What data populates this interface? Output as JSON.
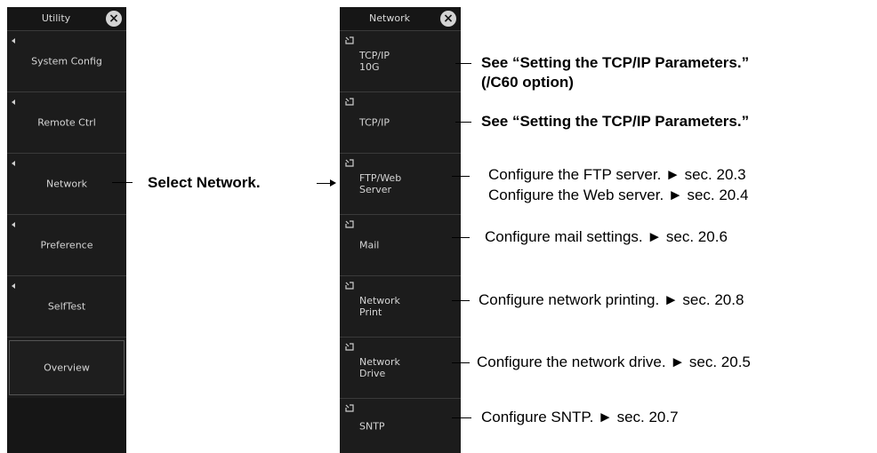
{
  "utility": {
    "title": "Utility",
    "close_glyph": "×",
    "items": [
      {
        "label": "System Config"
      },
      {
        "label": "Remote Ctrl"
      },
      {
        "label": "Network"
      },
      {
        "label": "Preference"
      },
      {
        "label": "SelfTest"
      }
    ],
    "overview_label": "Overview"
  },
  "network": {
    "title": "Network",
    "close_glyph": "×",
    "items": [
      {
        "label": "TCP/IP\n10G"
      },
      {
        "label": "TCP/IP"
      },
      {
        "label": "FTP/Web\nServer"
      },
      {
        "label": "Mail"
      },
      {
        "label": "Network\nPrint"
      },
      {
        "label": "Network\nDrive"
      },
      {
        "label": "SNTP"
      }
    ]
  },
  "annotations": {
    "select_network": "Select Network.",
    "tcpip10g_line1": "See “Setting the TCP/IP Parameters.”",
    "tcpip10g_line2": "(/C60 option)",
    "tcpip": "See “Setting the TCP/IP Parameters.”",
    "ftp_line1": "Configure the FTP server. ► sec. 20.3",
    "ftp_line2": "Configure the Web server. ► sec. 20.4",
    "mail": "Configure mail settings. ► sec. 20.6",
    "print": "Configure network printing. ► sec. 20.8",
    "drive": "Configure the network drive. ► sec. 20.5",
    "sntp": "Configure SNTP. ► sec. 20.7"
  },
  "colors": {
    "menu_bg": "#161616",
    "item_bg": "#1c1c1c",
    "text": "#d4d4d4"
  }
}
